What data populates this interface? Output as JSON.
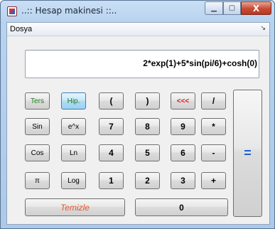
{
  "window": {
    "title": "..:: Hesap makinesi ::..",
    "controls": {
      "minimize": "▁",
      "maximize": "▢",
      "close": "X"
    }
  },
  "menu": {
    "items": [
      "Dosya"
    ],
    "overflow_arrow": "↘"
  },
  "display": {
    "expression": "2*exp(1)+5*sin(pi/6)+cosh(0)"
  },
  "keys": {
    "ters": "Ters",
    "hip": "Hip.",
    "open_paren": "(",
    "close_paren": ")",
    "backspace": "<<<",
    "divide": "/",
    "sin": "Sin",
    "exp": "e^x",
    "seven": "7",
    "eight": "8",
    "nine": "9",
    "multiply": "*",
    "cos": "Cos",
    "ln": "Ln",
    "four": "4",
    "five": "5",
    "six": "6",
    "minus": "-",
    "pi": "π",
    "log": "Log",
    "one": "1",
    "two": "2",
    "three": "3",
    "plus": "+",
    "clear": "Temizle",
    "zero": "0",
    "equals": "="
  },
  "colors": {
    "function_text": "#1f7a1f",
    "backspace_text": "#e01414",
    "clear_text": "#e05a2b",
    "equals_text": "#1e5fcf",
    "hip_active_bg": "#b0dcf5"
  }
}
